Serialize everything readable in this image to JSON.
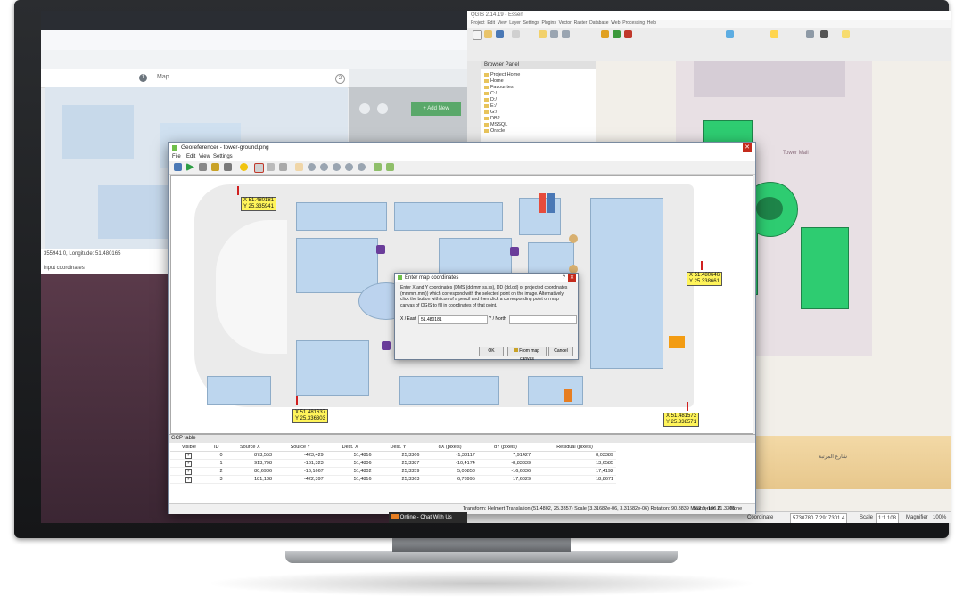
{
  "left_app": {
    "step_number": "1",
    "tab_label": "Map",
    "step_two": "2",
    "button_label": "+ Add New",
    "longitude_text": "355941 0, Longitude: 51.480165",
    "input_text": "input coordinates"
  },
  "qgis": {
    "title": "QGIS 2.14.19 - Essen",
    "menu": [
      "Project",
      "Edit",
      "View",
      "Layer",
      "Settings",
      "Plugins",
      "Vector",
      "Raster",
      "Database",
      "Web",
      "Processing",
      "Help"
    ],
    "browser_title": "Browser Panel",
    "browser_items": [
      "Project Home",
      "Home",
      "Favourites",
      "C:/",
      "D:/",
      "E:/",
      "G:/",
      "DB2",
      "MSSQL",
      "Oracle"
    ],
    "map_labels": [
      "Tower Mall",
      "شارع المرتبة"
    ],
    "status": {
      "coordinate_label": "Coordinate",
      "coordinate_value": "5730780.7,2917301.4",
      "scale_label": "Scale",
      "scale_value": "1:1 108",
      "magnifier_label": "Magnifier",
      "magnifier_value": "100%"
    }
  },
  "georef": {
    "title": "Georeferencer - tower-ground.png",
    "menu": [
      "File",
      "Edit",
      "View",
      "Settings"
    ],
    "gcp_labels": [
      {
        "x": "X 51.480181",
        "y": "Y 25.335941"
      },
      {
        "x": "X 51.480646",
        "y": "Y 25.338661"
      },
      {
        "x": "X 51.481637",
        "y": "Y 25.336303"
      },
      {
        "x": "X 51.481573",
        "y": "Y 25.338571"
      }
    ],
    "gcp_table_title": "GCP table",
    "gcp_columns": [
      "Visible",
      "ID",
      "Source X",
      "Source Y",
      "Dest. X",
      "Dest. Y",
      "dX (pixels)",
      "dY (pixels)",
      "Residual (pixels)"
    ],
    "gcp_rows": [
      [
        "0",
        "873,553",
        "-423,429",
        "51,4816",
        "25,3366",
        "-1,38117",
        "7,91427",
        "8,03389"
      ],
      [
        "1",
        "913,798",
        "-161,323",
        "51,4806",
        "25,3387",
        "-10,4174",
        "-8,83339",
        "13,6585"
      ],
      [
        "2",
        "80,6986",
        "-16,1667",
        "51,4802",
        "25,3359",
        "5,00858",
        "-16,6836",
        "17,4192"
      ],
      [
        "3",
        "181,138",
        "-422,397",
        "51,4816",
        "25,3363",
        "6,78995",
        "17,6029",
        "18,8671"
      ]
    ],
    "status_text": "Transform: Helmert Translation (51.4802, 25.3357) Scale (3.31682e-06, 3.31682e-06) Rotation: 90.8839 Mean error: 21.3365",
    "status_coords": "562.9,-106.6",
    "status_crs": "None"
  },
  "dialog": {
    "title": "Enter map coordinates",
    "message": "Enter X and Y coordinates (DMS (dd mm ss.ss), DD (dd.dd) or projected coordinates (mmmm.mm)) which correspond with the selected point on the image. Alternatively, click the button with icon of a pencil and then click a corresponding point on map canvas of QGIS to fill in coordinates of that point.",
    "x_label": "X / East",
    "x_value": "51.480181",
    "y_label": "Y / North",
    "y_value": "",
    "ok_label": "OK",
    "from_canvas_label": "From map canvas",
    "cancel_label": "Cancel"
  },
  "taskbar": {
    "chat_label": "Online - Chat With Us"
  },
  "colors": {
    "room_blue": "#bdd6ee",
    "gcp_yellow": "#fff45a",
    "mall_green": "#2ecc71",
    "accent_purple": "#6a3d9a"
  }
}
